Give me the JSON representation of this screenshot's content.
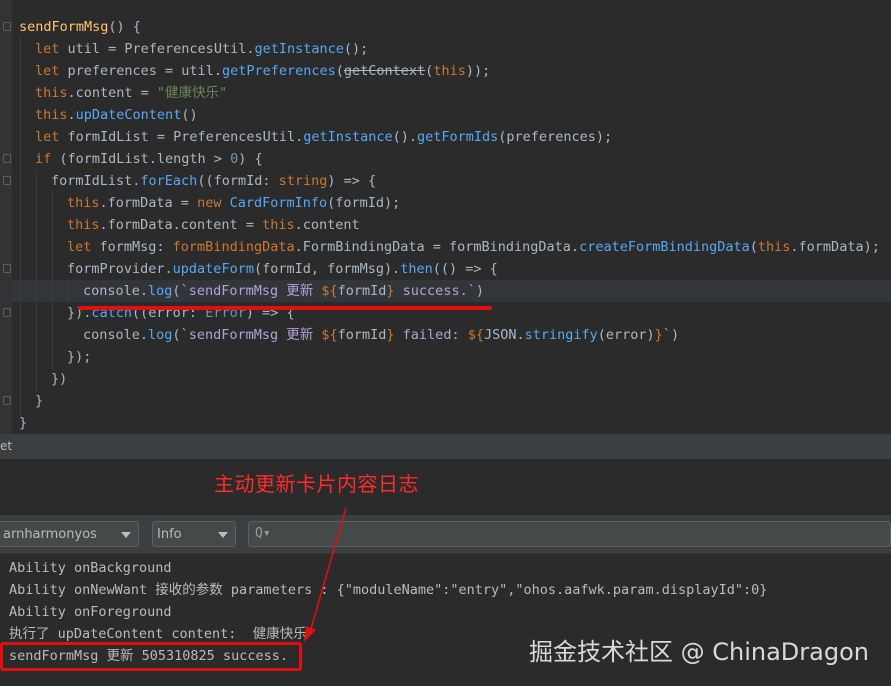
{
  "editor": {
    "lines": [
      [
        [
          "t-fn",
          "sendFormMsg"
        ],
        [
          "t-plain",
          "() {"
        ]
      ],
      [
        [
          "t-kw",
          "let "
        ],
        [
          "t-plain",
          "util = PreferencesUtil."
        ],
        [
          "t-method",
          "getInstance"
        ],
        [
          "t-plain",
          "();"
        ]
      ],
      [
        [
          "t-kw",
          "let "
        ],
        [
          "t-plain",
          "preferences = util."
        ],
        [
          "t-method",
          "getPreferences"
        ],
        [
          "t-plain",
          "("
        ],
        [
          "t-strike",
          "getContext"
        ],
        [
          "t-plain",
          "("
        ],
        [
          "t-kw",
          "this"
        ],
        [
          "t-plain",
          "));"
        ]
      ],
      [
        [
          "t-kw",
          "this"
        ],
        [
          "t-plain",
          ".content = "
        ],
        [
          "t-str",
          "\"健康快乐\""
        ]
      ],
      [
        [
          "t-kw",
          "this"
        ],
        [
          "t-plain",
          "."
        ],
        [
          "t-method",
          "upDateContent"
        ],
        [
          "t-plain",
          "()"
        ]
      ],
      [
        [
          "t-kw",
          "let "
        ],
        [
          "t-plain",
          "formIdList = PreferencesUtil."
        ],
        [
          "t-method",
          "getInstance"
        ],
        [
          "t-plain",
          "()."
        ],
        [
          "t-method",
          "getFormIds"
        ],
        [
          "t-plain",
          "(preferences);"
        ]
      ],
      [
        [
          "t-kw",
          "if "
        ],
        [
          "t-plain",
          "(formIdList.length > "
        ],
        [
          "t-num",
          "0"
        ],
        [
          "t-plain",
          ") {"
        ]
      ],
      [
        [
          "t-plain",
          "formIdList."
        ],
        [
          "t-method",
          "forEach"
        ],
        [
          "t-plain",
          "((formId: "
        ],
        [
          "t-kw",
          "string"
        ],
        [
          "t-plain",
          ") => {"
        ]
      ],
      [
        [
          "t-kw",
          "this"
        ],
        [
          "t-plain",
          ".formData = "
        ],
        [
          "t-kw",
          "new "
        ],
        [
          "t-method",
          "CardFormInfo"
        ],
        [
          "t-plain",
          "(formId);"
        ]
      ],
      [
        [
          "t-kw",
          "this"
        ],
        [
          "t-plain",
          ".formData.content = "
        ],
        [
          "t-kw",
          "this"
        ],
        [
          "t-plain",
          ".content"
        ]
      ],
      [
        [
          "t-kw",
          "let "
        ],
        [
          "t-plain",
          "formMsg: "
        ],
        [
          "t-kw",
          "formBindingData"
        ],
        [
          "t-plain",
          ".FormBindingData = formBindingData."
        ],
        [
          "t-method",
          "createFormBindingData"
        ],
        [
          "t-plain",
          "("
        ],
        [
          "t-kw",
          "this"
        ],
        [
          "t-plain",
          ".formData);"
        ]
      ],
      [
        [
          "t-plain",
          "formProvider."
        ],
        [
          "t-method",
          "updateForm"
        ],
        [
          "t-plain",
          "(formId, formMsg)."
        ],
        [
          "t-method",
          "then"
        ],
        [
          "t-plain",
          "(() => {"
        ]
      ],
      [
        [
          "t-plain",
          "console."
        ],
        [
          "t-method",
          "log"
        ],
        [
          "t-plain",
          "("
        ],
        [
          "t-tmpl",
          "`sendFormMsg 更新 "
        ],
        [
          "t-kw",
          "${"
        ],
        [
          "t-plain",
          "formId"
        ],
        [
          "t-kw",
          "}"
        ],
        [
          "t-tmpl",
          " success.`"
        ],
        [
          "t-plain",
          ")"
        ]
      ],
      [
        [
          "t-plain",
          "})."
        ],
        [
          "t-method",
          "catch"
        ],
        [
          "t-plain",
          "((error: "
        ],
        [
          "t-type",
          "Error"
        ],
        [
          "t-plain",
          ") => {"
        ]
      ],
      [
        [
          "t-plain",
          "console."
        ],
        [
          "t-method",
          "log"
        ],
        [
          "t-plain",
          "("
        ],
        [
          "t-tmpl",
          "`sendFormMsg 更新 "
        ],
        [
          "t-kw",
          "${"
        ],
        [
          "t-plain",
          "formId"
        ],
        [
          "t-kw",
          "}"
        ],
        [
          "t-tmpl",
          " failed: "
        ],
        [
          "t-kw",
          "${"
        ],
        [
          "t-plain",
          "JSON."
        ],
        [
          "t-method",
          "stringify"
        ],
        [
          "t-plain",
          "(error)"
        ],
        [
          "t-kw",
          "}"
        ],
        [
          "t-tmpl",
          "`"
        ],
        [
          "t-plain",
          ")"
        ]
      ],
      [
        [
          "t-plain",
          "});"
        ]
      ],
      [
        [
          "t-plain",
          "})"
        ]
      ],
      [
        [
          "t-plain",
          "}"
        ]
      ],
      [
        [
          "t-plain",
          "}"
        ]
      ]
    ]
  },
  "tool_window": {
    "title": "et"
  },
  "annotation": "主动更新卡片内容日志",
  "toolbar": {
    "device_select": "arnharmonyos",
    "level_select": "Info",
    "search_icon": "Q▾",
    "search_value": ""
  },
  "log": {
    "lines": [
      "Ability onBackground",
      "Ability onNewWant 接收的参数 parameters : {\"moduleName\":\"entry\",\"ohos.aafwk.param.displayId\":0}",
      "Ability onForeground",
      "执行了 upDateContent content:  健康快乐",
      "sendFormMsg 更新 505310825 success."
    ]
  },
  "watermark": "掘金技术社区 @ ChinaDragon",
  "colors": {
    "editor_bg": "#2b2b2b",
    "keyword": "#cc7832",
    "function": "#ffc66d",
    "method": "#56a8f5",
    "string": "#6a8759",
    "annotation_red": "#e01010"
  }
}
